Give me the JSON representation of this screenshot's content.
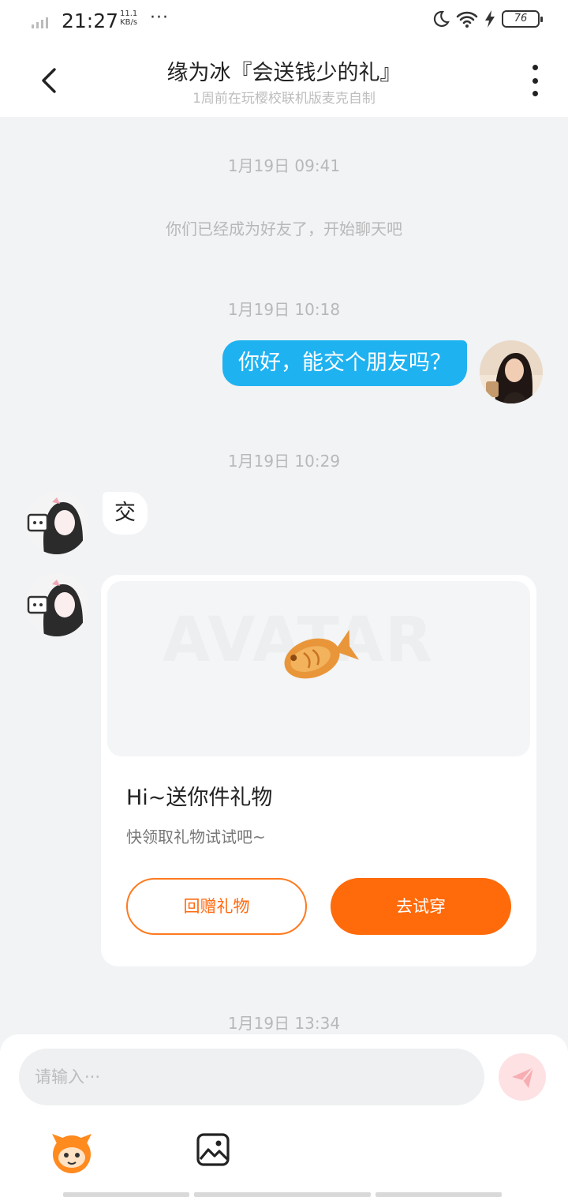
{
  "status_bar": {
    "time": "21:27",
    "speed_value": "11.1",
    "speed_unit": "KB/s",
    "dots": "···",
    "battery": "76",
    "icons": [
      "signal-icon",
      "moon-icon",
      "wifi-icon",
      "charging-icon",
      "battery-icon"
    ]
  },
  "header": {
    "title": "缘为冰『会送钱少的礼』",
    "subtitle": "1周前在玩樱校联机版麦克自制",
    "icons": [
      "back-icon",
      "more-icon"
    ]
  },
  "chat": {
    "timestamps": [
      "1月19日 09:41",
      "1月19日 10:18",
      "1月19日 10:29",
      "1月19日 13:34"
    ],
    "system_message": "你们已经成为好友了，开始聊天吧",
    "outgoing_message": "你好，能交个朋友吗？",
    "incoming_message": "交",
    "gift_card": {
      "watermark": "AVATAR",
      "title": "Hi~送你件礼物",
      "subtitle": "快领取礼物试试吧~",
      "return_gift_label": "回赠礼物",
      "try_on_label": "去试穿"
    }
  },
  "input": {
    "placeholder": "请输入···",
    "icons": [
      "send-icon",
      "mascot-icon",
      "image-icon"
    ]
  },
  "colors": {
    "outgoing_bubble": "#1eb2f1",
    "accent_orange": "#ff6a0a",
    "send_button": "#fde1e3",
    "background": "#f1f3f5"
  }
}
